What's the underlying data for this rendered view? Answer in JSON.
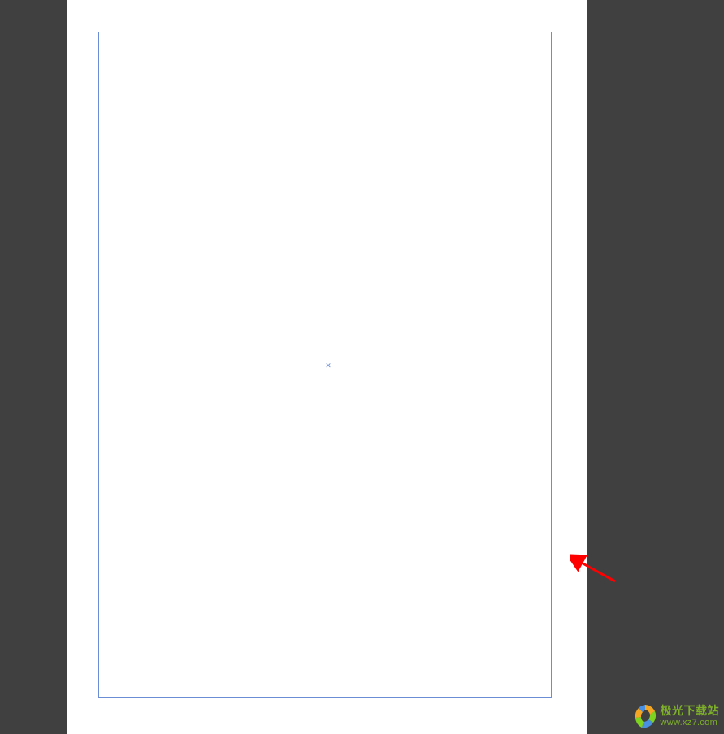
{
  "document": {
    "center_mark": "✕"
  },
  "watermark": {
    "title": "极光下载站",
    "url": "www.xz7.com"
  }
}
